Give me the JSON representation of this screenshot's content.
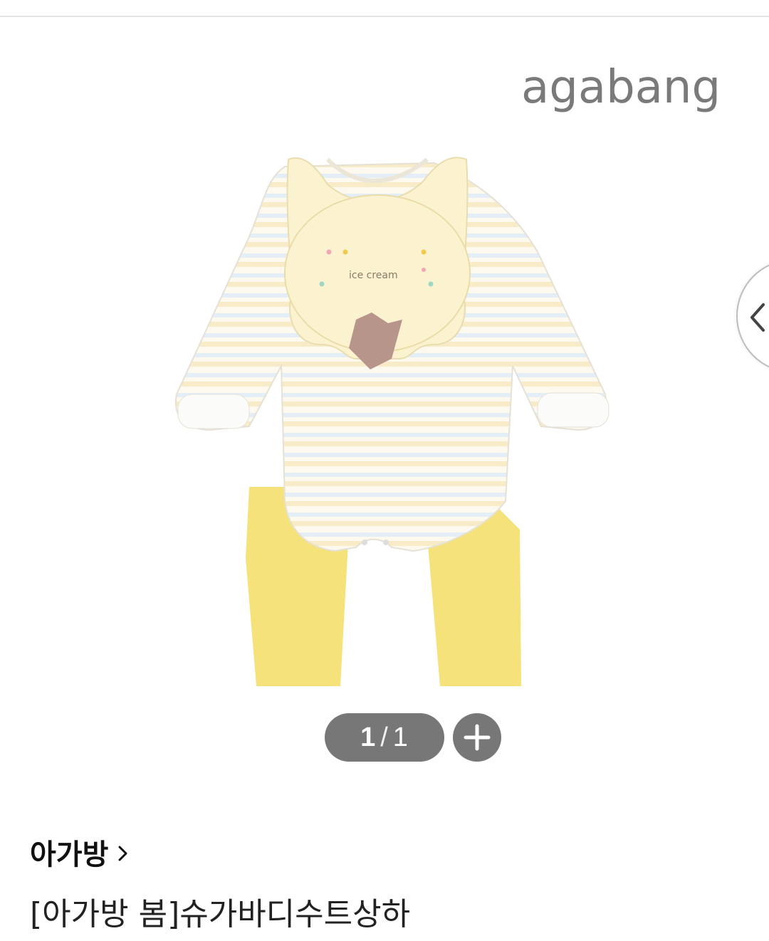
{
  "gallery": {
    "logo_text": "agabang",
    "bib_text": "ice cream",
    "image_alt": "product-image",
    "counter": {
      "current": "1",
      "separator": "/",
      "total": "1"
    },
    "zoom_icon": "plus-icon",
    "prev_icon": "chevron-left-icon"
  },
  "product": {
    "brand": "아가방",
    "brand_icon": "chevron-right-icon",
    "title": "[아가방 봄]슈가바디수트상하"
  },
  "colors": {
    "counter_bg": "#777777",
    "logo_gray": "#7a7a7a",
    "pants_yellow": "#f6e27a",
    "bib_cream": "#fbf3cf"
  }
}
